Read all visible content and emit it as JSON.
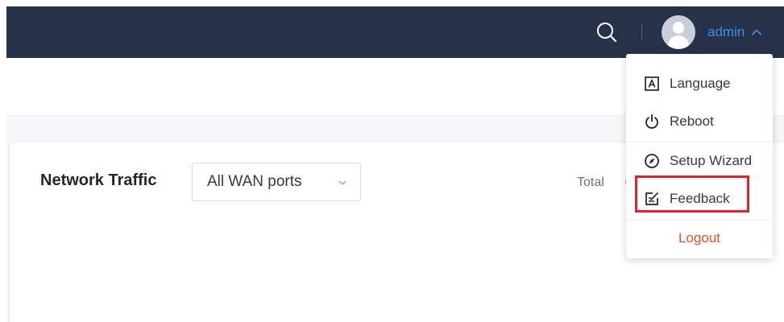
{
  "topbar": {
    "search_icon": "search-icon",
    "user": {
      "avatar_icon": "user-avatar-icon",
      "name": "admin",
      "chevron_icon": "chevron-up-icon"
    }
  },
  "card": {
    "title": "Network Traffic",
    "wan_select": {
      "value": "All WAN ports",
      "chevron_icon": "chevron-down-icon"
    },
    "total_label": "Total"
  },
  "user_menu": {
    "items": [
      {
        "label": "Language",
        "icon": "language-icon"
      },
      {
        "label": "Reboot",
        "icon": "power-icon"
      },
      {
        "label": "Setup Wizard",
        "icon": "compass-icon"
      },
      {
        "label": "Feedback",
        "icon": "edit-note-icon"
      }
    ],
    "highlighted_item": "Feedback",
    "logout_label": "Logout"
  },
  "colors": {
    "topbar_bg": "#273249",
    "accent": "#3a8eea",
    "logout": "#e0532e",
    "highlight": "#d9262e"
  }
}
